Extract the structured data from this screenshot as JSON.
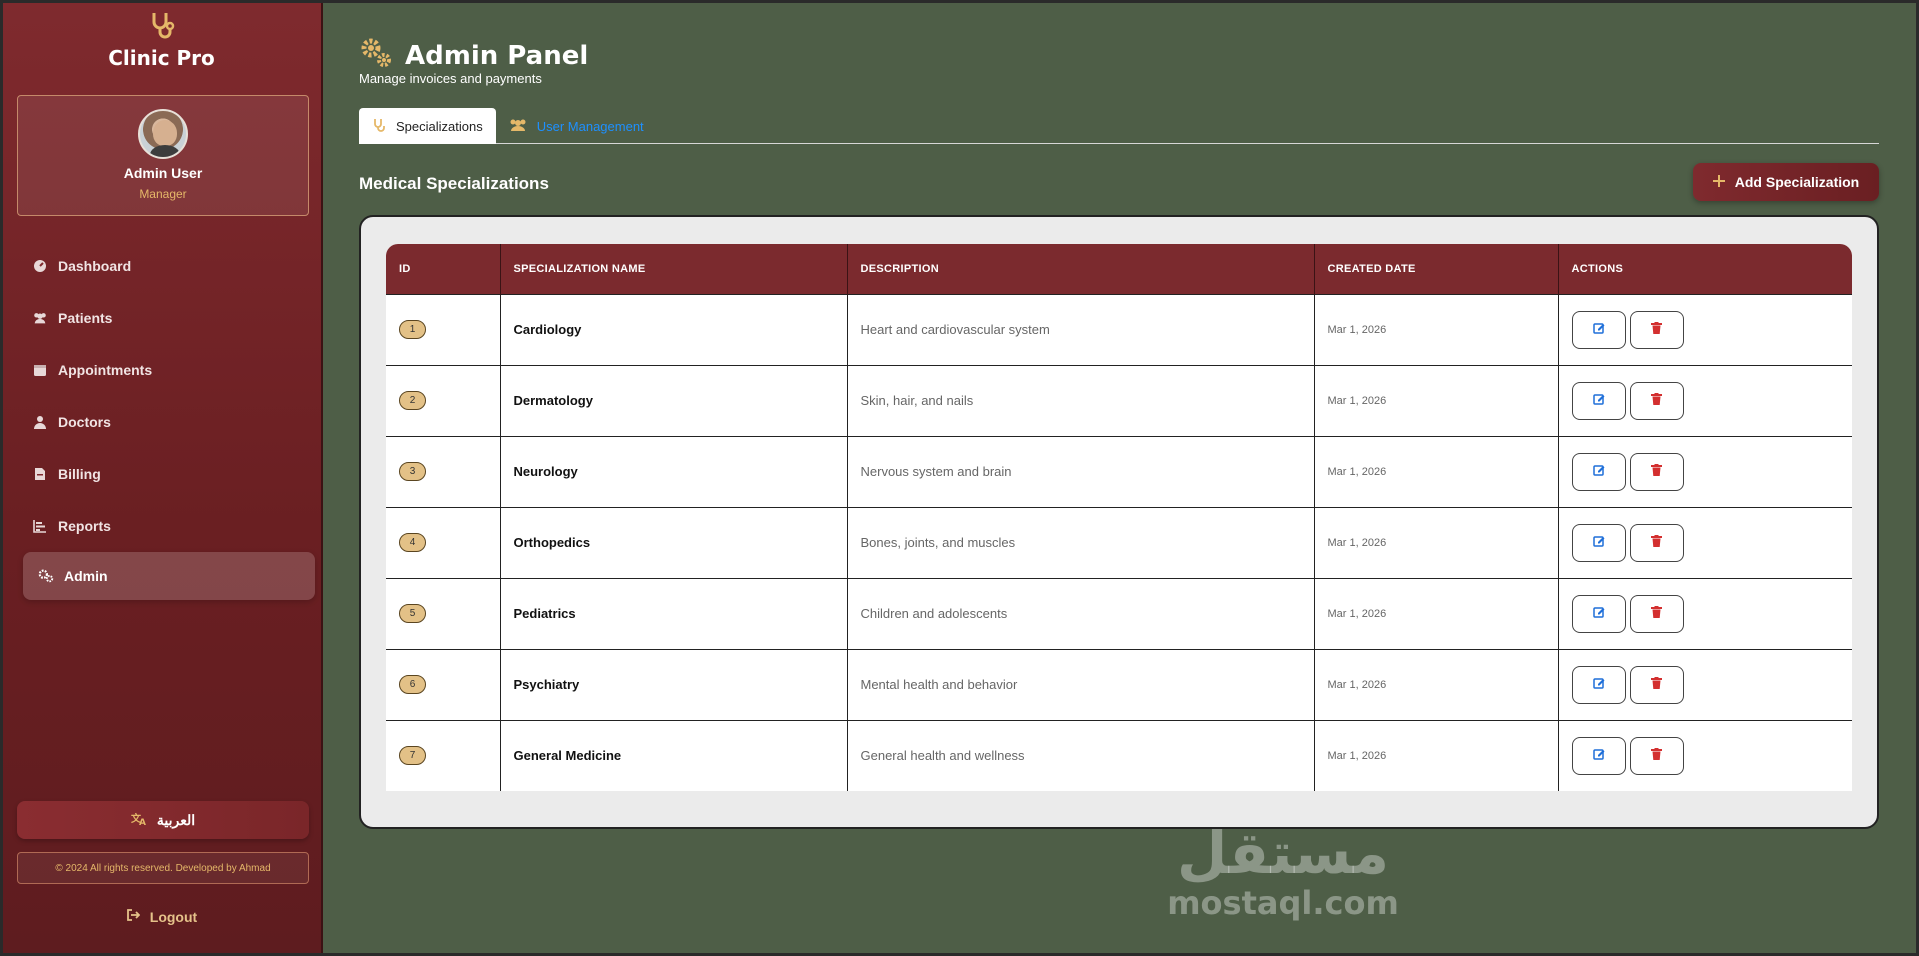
{
  "app": {
    "name": "Clinic Pro",
    "logo_icon": "stethoscope-icon"
  },
  "profile": {
    "name": "Admin User",
    "role": "Manager"
  },
  "nav": {
    "items": [
      {
        "label": "Dashboard",
        "icon": "gauge-icon"
      },
      {
        "label": "Patients",
        "icon": "users-icon"
      },
      {
        "label": "Appointments",
        "icon": "calendar-icon"
      },
      {
        "label": "Doctors",
        "icon": "user-doctor-icon"
      },
      {
        "label": "Billing",
        "icon": "invoice-icon"
      },
      {
        "label": "Reports",
        "icon": "chart-bar-icon"
      },
      {
        "label": "Admin",
        "icon": "cogs-icon",
        "active": true
      }
    ]
  },
  "sidebar_footer": {
    "language_label": "العربية",
    "copyright": "© 2024 All rights reserved. Developed by Ahmad",
    "logout_label": "Logout"
  },
  "header": {
    "title": "Admin Panel",
    "subtitle": "Manage invoices and payments"
  },
  "tabs": [
    {
      "label": "Specializations",
      "active": true
    },
    {
      "label": "User Management",
      "active": false
    }
  ],
  "section": {
    "title": "Medical Specializations",
    "add_button_label": "Add Specialization"
  },
  "table": {
    "columns": [
      "ID",
      "SPECIALIZATION NAME",
      "DESCRIPTION",
      "CREATED DATE",
      "ACTIONS"
    ],
    "rows": [
      {
        "id": "1",
        "name": "Cardiology",
        "description": "Heart and cardiovascular system",
        "date": "Mar 1, 2026"
      },
      {
        "id": "2",
        "name": "Dermatology",
        "description": "Skin, hair, and nails",
        "date": "Mar 1, 2026"
      },
      {
        "id": "3",
        "name": "Neurology",
        "description": "Nervous system and brain",
        "date": "Mar 1, 2026"
      },
      {
        "id": "4",
        "name": "Orthopedics",
        "description": "Bones, joints, and muscles",
        "date": "Mar 1, 2026"
      },
      {
        "id": "5",
        "name": "Pediatrics",
        "description": "Children and adolescents",
        "date": "Mar 1, 2026"
      },
      {
        "id": "6",
        "name": "Psychiatry",
        "description": "Mental health and behavior",
        "date": "Mar 1, 2026"
      },
      {
        "id": "7",
        "name": "General Medicine",
        "description": "General health and wellness",
        "date": "Mar 1, 2026"
      }
    ]
  },
  "watermark": {
    "arabic": "مستقل",
    "latin": "mostaql.com"
  },
  "colors": {
    "sidebar": "#7f2a2e",
    "background": "#4e5e47",
    "accent_gold": "#e5b869",
    "link_blue": "#1e90ff",
    "delete_red": "#d32f2f"
  }
}
